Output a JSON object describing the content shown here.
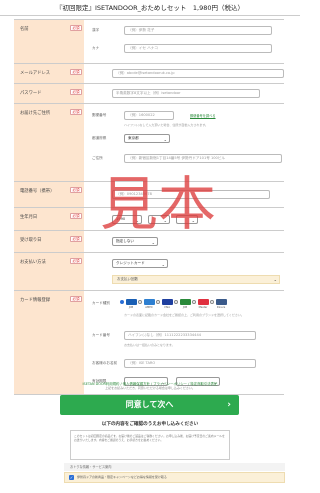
{
  "page": {
    "title": "『初回限定』ISETANDOOR_おためしセット　1,980円（税込）",
    "watermark": "見本"
  },
  "labels": {
    "required": "必須",
    "name": "名前",
    "email": "メールアドレス",
    "password": "パスワード",
    "address": "お届け先ご住所",
    "phone": "電話番号（携帯）",
    "birthdate": "生年月日",
    "delivery_date": "受け取り日",
    "payment": "お支払い方法",
    "card_info": "カード情報登録"
  },
  "name": {
    "last_label": "漢字",
    "first_label": "カナ",
    "kanji_placeholder": "（例）伊勢 花子",
    "kana_placeholder": "（例）イセ ハナコ"
  },
  "email": {
    "placeholder": "（例）abcde@isetandooruk.co.jp"
  },
  "password": {
    "placeholder": "半角英数字8文字以上（例）isetandoor"
  },
  "address": {
    "postal_label": "郵便番号",
    "postal_placeholder": "（例）1600022",
    "postal_link": "郵便番号を調べる",
    "postal_note": "ハイフン(-)なしで入力頂いた場合、住所が自動入力されます。",
    "pref_label": "都道府県",
    "pref_value": "東京都",
    "addr_label": "ご住所",
    "addr_placeholder": "（例）新宿区新宿1丁目14番5号 伊勢丹ドア101号 100ビル"
  },
  "phone": {
    "placeholder": "（例）09012345678"
  },
  "birthdate": {
    "year": "1990"
  },
  "delivery": {
    "note": "指定しない"
  },
  "payment": {
    "method": "クレジットカード",
    "box_text": "お支払い回数"
  },
  "card": {
    "brand_label": "カード種別",
    "brands": [
      {
        "name": "JCB",
        "color": "#1a5fb4",
        "checked": true
      },
      {
        "name": "AMEX",
        "color": "#2e7fd0",
        "checked": false
      },
      {
        "name": "VISA",
        "color": "#1f3f9f",
        "checked": false
      },
      {
        "name": "JCB",
        "color": "#2a8a3a",
        "checked": false
      },
      {
        "name": "Master",
        "color": "#e0303f",
        "checked": false
      },
      {
        "name": "Diners",
        "color": "#3a5a8a",
        "checked": false
      }
    ],
    "brand_note": "カードの表面に記載のカード会社をご確認の上、ご利用のブランドを選択してください。",
    "number_label": "カード番号",
    "number_placeholder": "ハイフン(-)なし（例）1111222233334444",
    "number_note": "お支払いは一括払いのみとなります。",
    "holder_label": "お客様のお名前",
    "holder_placeholder": "（例）ISE TARO",
    "expiry_label": "有効期限"
  },
  "footer": {
    "policy_text": "ISETAN DOOR利用規約 / 個人情報保護方針 / プライバシーポリシー / 特定商取引法表記",
    "policy_note": "上記をお読みいただき、同意いただける場合は申し込みください。",
    "submit": "同意して次へ",
    "submit_arrow": "›",
    "confirm_heading": "以下の内容をご確認のうえお申し込みください",
    "confirm_text": "このセットは初回限定の商品です。お届け後のご返品はご容赦ください。お申し込み後、お届け予定日のご案内メールをお送りいたします。内容をご確認のうえ、お手続きをお進めください。",
    "option_label": "おトクな情報・サービス案内",
    "option_text": "伊勢丹ドアの新商品・限定キャンペーンなどお得な情報を受け取る"
  }
}
